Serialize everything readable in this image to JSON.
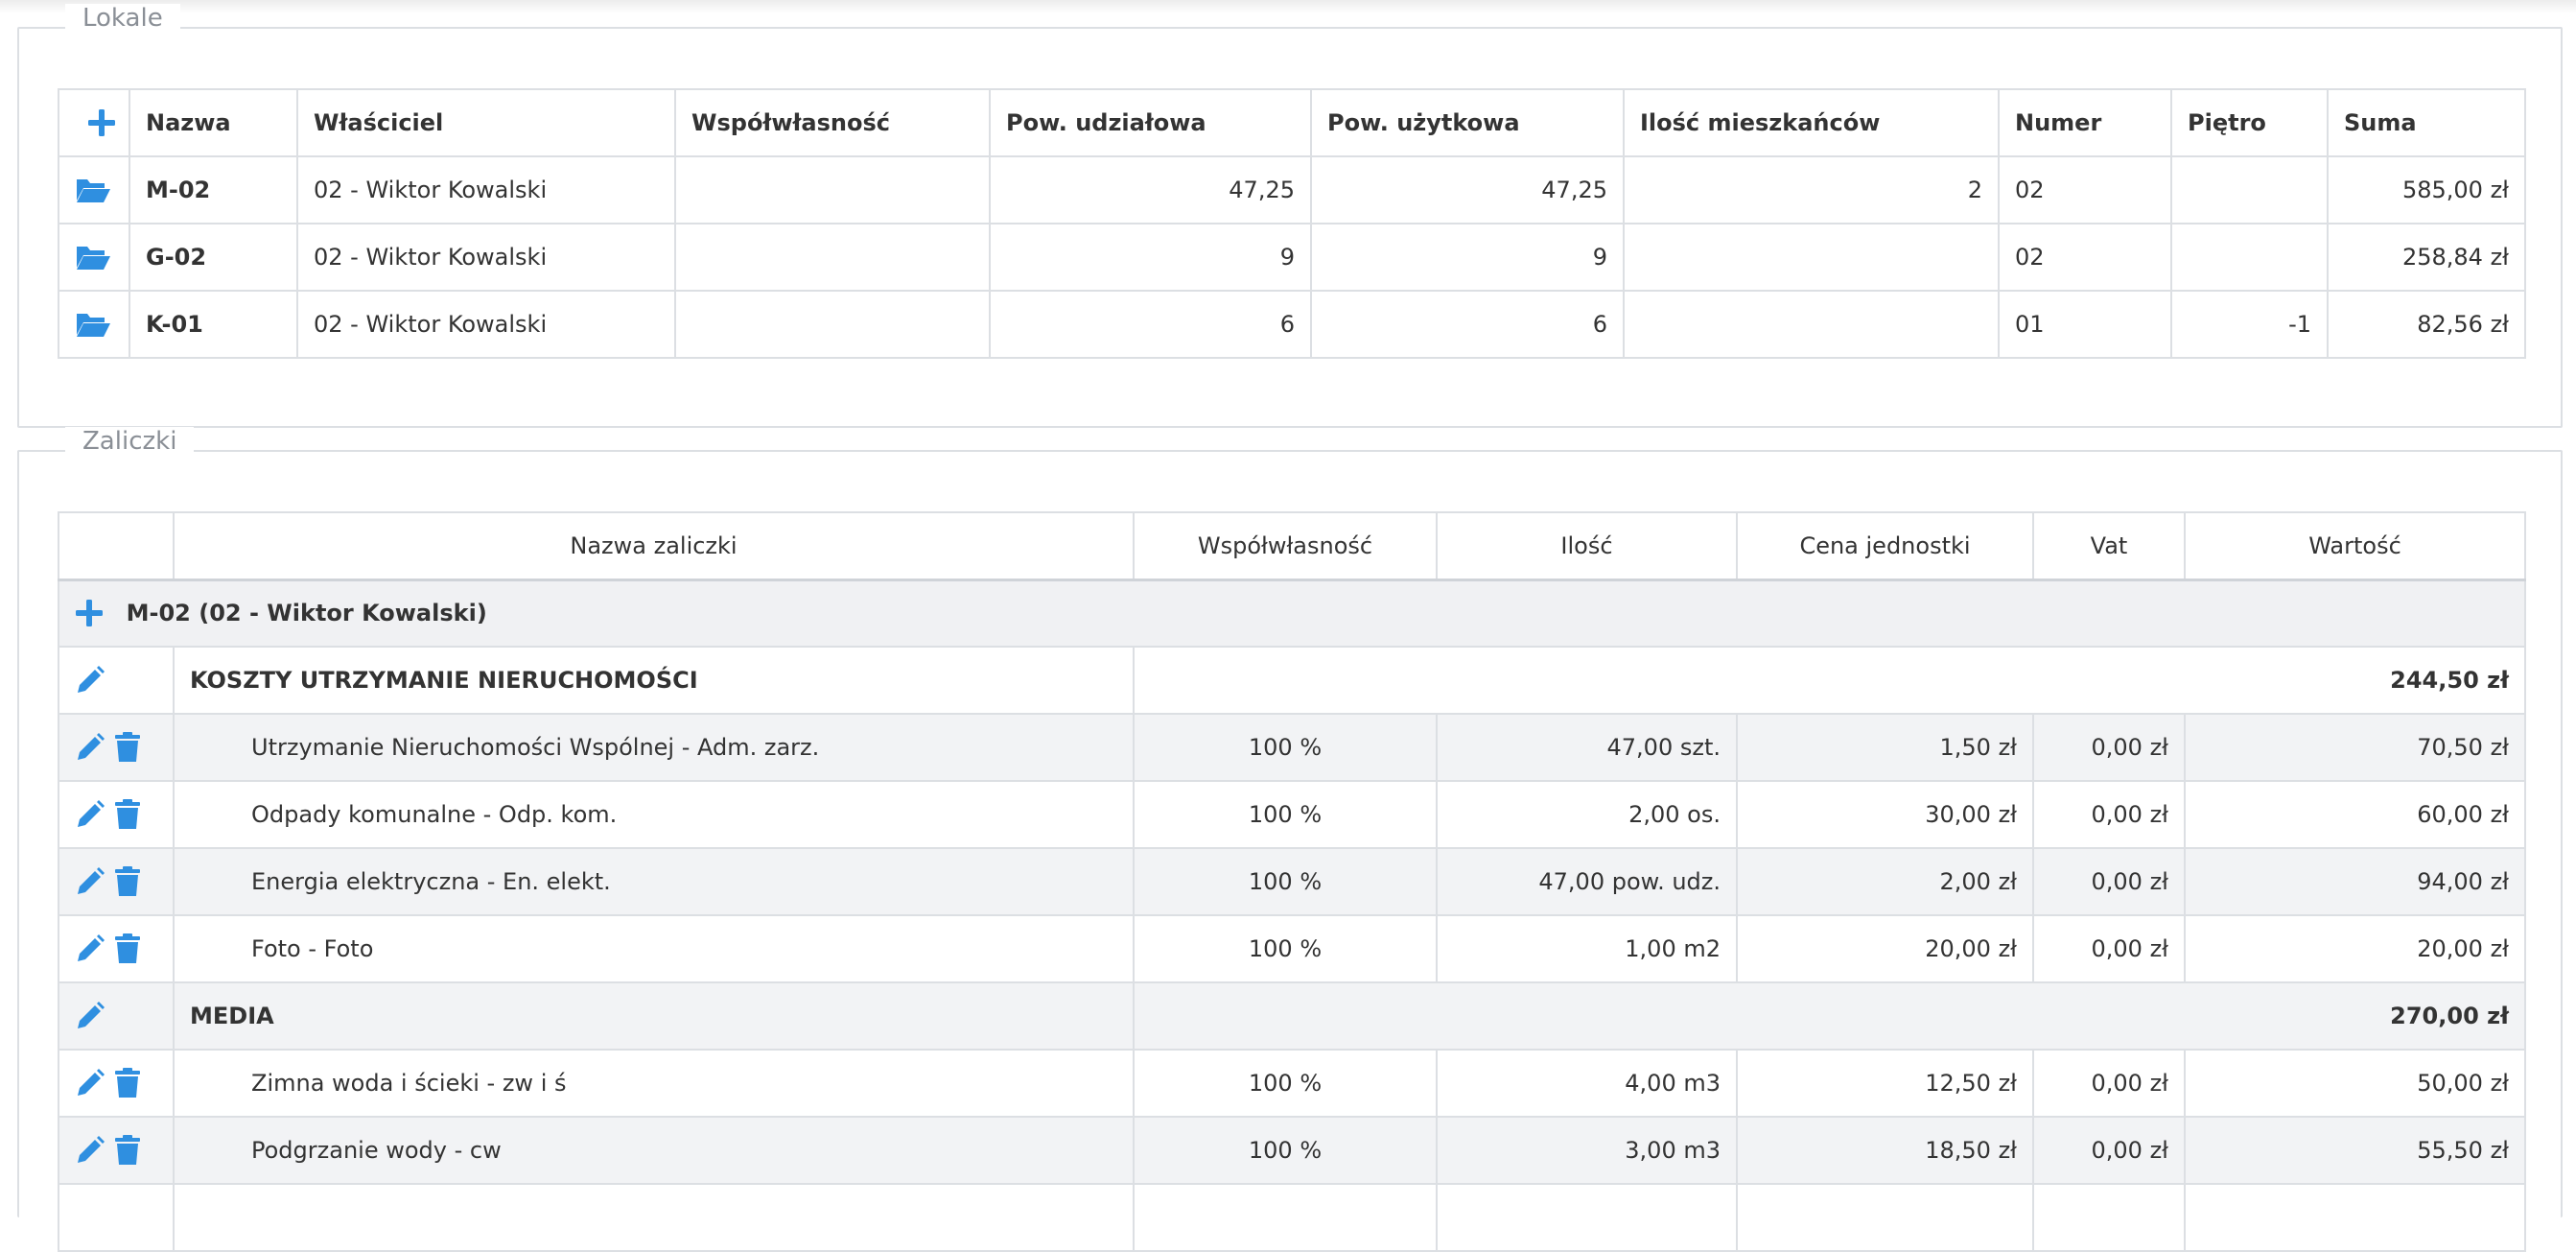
{
  "colors": {
    "accent": "#2f8fe0",
    "border": "#dcdfe3",
    "stripe": "#f2f3f5"
  },
  "lokale": {
    "legend": "Lokale",
    "headers": [
      "Nazwa",
      "Właściciel",
      "Współwłasność",
      "Pow. udziałowa",
      "Pow. użytkowa",
      "Ilość mieszkańców",
      "Numer",
      "Piętro",
      "Suma"
    ],
    "rows": [
      {
        "nazwa": "M-02",
        "wlasciciel": "02 - Wiktor Kowalski",
        "wspolwlasnosc": "",
        "pow_udz": "47,25",
        "pow_uzyt": "47,25",
        "mieszkancy": "2",
        "numer": "02",
        "pietro": "",
        "suma": "585,00 zł"
      },
      {
        "nazwa": "G-02",
        "wlasciciel": "02 - Wiktor Kowalski",
        "wspolwlasnosc": "",
        "pow_udz": "9",
        "pow_uzyt": "9",
        "mieszkancy": "",
        "numer": "02",
        "pietro": "",
        "suma": "258,84 zł"
      },
      {
        "nazwa": "K-01",
        "wlasciciel": "02 - Wiktor Kowalski",
        "wspolwlasnosc": "",
        "pow_udz": "6",
        "pow_uzyt": "6",
        "mieszkancy": "",
        "numer": "01",
        "pietro": "-1",
        "suma": "82,56 zł"
      }
    ]
  },
  "zaliczki": {
    "legend": "Zaliczki",
    "headers": [
      "Nazwa zaliczki",
      "Współwłasność",
      "Ilość",
      "Cena jednostki",
      "Vat",
      "Wartość"
    ],
    "group_label": "M-02 (02 - Wiktor Kowalski)",
    "categories": [
      {
        "name": "KOSZTY UTRZYMANIE NIERUCHOMOŚCI",
        "total": "244,50 zł",
        "items": [
          {
            "name": "Utrzymanie Nieruchomości Wspólnej - Adm. zarz.",
            "share": "100 %",
            "qty": "47,00 szt.",
            "price": "1,50 zł",
            "vat": "0,00 zł",
            "value": "70,50 zł"
          },
          {
            "name": "Odpady komunalne - Odp. kom.",
            "share": "100 %",
            "qty": "2,00 os.",
            "price": "30,00 zł",
            "vat": "0,00 zł",
            "value": "60,00 zł"
          },
          {
            "name": "Energia elektryczna - En. elekt.",
            "share": "100 %",
            "qty": "47,00 pow. udz.",
            "price": "2,00 zł",
            "vat": "0,00 zł",
            "value": "94,00 zł"
          },
          {
            "name": "Foto - Foto",
            "share": "100 %",
            "qty": "1,00 m2",
            "price": "20,00 zł",
            "vat": "0,00 zł",
            "value": "20,00 zł"
          }
        ]
      },
      {
        "name": "MEDIA",
        "total": "270,00 zł",
        "items": [
          {
            "name": "Zimna woda i ścieki - zw i ś",
            "share": "100 %",
            "qty": "4,00 m3",
            "price": "12,50 zł",
            "vat": "0,00 zł",
            "value": "50,00 zł"
          },
          {
            "name": "Podgrzanie wody - cw",
            "share": "100 %",
            "qty": "3,00 m3",
            "price": "18,50 zł",
            "vat": "0,00 zł",
            "value": "55,50 zł"
          }
        ]
      }
    ]
  }
}
